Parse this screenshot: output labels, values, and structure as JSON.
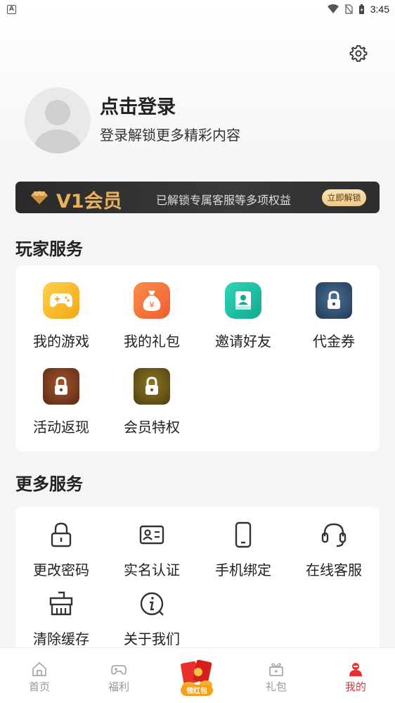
{
  "status": {
    "time": "3:45",
    "left_icon": "A"
  },
  "profile": {
    "title": "点击登录",
    "subtitle": "登录解锁更多精彩内容"
  },
  "vip": {
    "level": "V1会员",
    "description": "已解锁专属客服等多项权益",
    "button": "立即解锁",
    "colors": {
      "gold": "#e9b15a",
      "banner_bg": "#2f2f2f"
    }
  },
  "player_services": {
    "title": "玩家服务",
    "items": [
      {
        "label": "我的游戏",
        "icon": "gamepad-icon",
        "color": "#f7b928",
        "locked": false
      },
      {
        "label": "我的礼包",
        "icon": "money-bag-icon",
        "color": "#f47a3c",
        "locked": false
      },
      {
        "label": "邀请好友",
        "icon": "invite-icon",
        "color": "#1bbfa5",
        "locked": false
      },
      {
        "label": "代金券",
        "icon": "lock-icon",
        "color": "#2d4f6d",
        "locked": true
      },
      {
        "label": "活动返现",
        "icon": "lock-icon",
        "color": "#7a3e22",
        "locked": true
      },
      {
        "label": "会员特权",
        "icon": "lock-icon",
        "color": "#6e5a1c",
        "locked": true
      }
    ]
  },
  "more_services": {
    "title": "更多服务",
    "items": [
      {
        "label": "更改密码",
        "icon": "padlock-icon"
      },
      {
        "label": "实名认证",
        "icon": "id-card-icon"
      },
      {
        "label": "手机绑定",
        "icon": "phone-icon"
      },
      {
        "label": "在线客服",
        "icon": "headset-icon"
      },
      {
        "label": "清除缓存",
        "icon": "broom-icon"
      },
      {
        "label": "关于我们",
        "icon": "info-icon"
      }
    ]
  },
  "tabbar": {
    "items": [
      {
        "label": "首页",
        "icon": "home-icon"
      },
      {
        "label": "福利",
        "icon": "gamepad-icon"
      },
      {
        "label": "领红包",
        "icon": "red-packet-icon"
      },
      {
        "label": "礼包",
        "icon": "gift-icon"
      },
      {
        "label": "我的",
        "icon": "user-icon",
        "active": true
      }
    ],
    "active_color": "#e8302c"
  }
}
